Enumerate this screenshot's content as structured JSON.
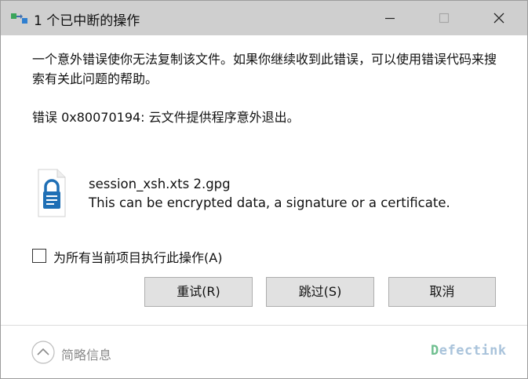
{
  "window": {
    "title": "1 个已中断的操作"
  },
  "titlebar": {
    "icon": "transfer-icon",
    "minimize_icon": "minimize-icon",
    "maximize_icon": "maximize-icon",
    "close_icon": "close-icon"
  },
  "message": {
    "text": "一个意外错误使你无法复制该文件。如果你继续收到此错误，可以使用错误代码来搜索有关此问题的帮助。",
    "error_line": "错误 0x80070194: 云文件提供程序意外退出。"
  },
  "file": {
    "icon": "locked-document-icon",
    "name": "session_xsh.xts 2.gpg",
    "description": "This can be encrypted data, a signature or a certificate."
  },
  "apply_all": {
    "label": "为所有当前项目执行此操作(A)",
    "checked": false
  },
  "buttons": {
    "retry": "重试(R)",
    "skip": "跳过(S)",
    "cancel": "取消"
  },
  "footer": {
    "details_icon": "chevron-up-icon",
    "details_label": "简略信息",
    "watermark_first": "D",
    "watermark_rest": "efectink"
  },
  "colors": {
    "titlebar": "#cfcfcf",
    "button_bg": "#e1e1e1",
    "icon_blue": "#1f6fb5",
    "watermark_green": "#6fbf8f",
    "watermark_blue": "#a9c3db"
  }
}
